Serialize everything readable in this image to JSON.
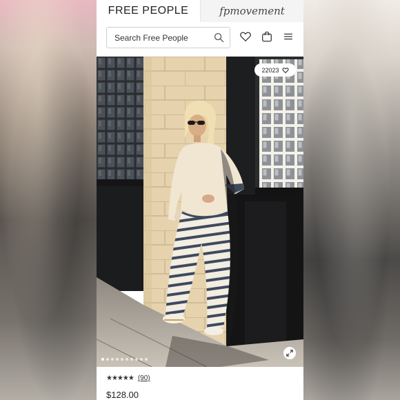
{
  "header": {
    "brand": "FREE PEOPLE",
    "secondary_brand": "fpmovement"
  },
  "search": {
    "placeholder": "Search Free People"
  },
  "icons": {
    "search": "search-icon",
    "wishlist": "heart-icon",
    "bag": "shopping-bag-icon",
    "menu": "hamburger-menu-icon",
    "expand": "expand-icon"
  },
  "product": {
    "likes": "22023",
    "rating": 4.5,
    "stars_display": "★★★★★",
    "review_count": "(90)",
    "price": "$128.00",
    "image_count": 10,
    "active_image": 1
  },
  "colors": {
    "wall_cream": "#e8d8b8",
    "wall_dark": "#1f1f21",
    "sweater": "#f1e6d2",
    "stripe": "#3e4a5c"
  }
}
